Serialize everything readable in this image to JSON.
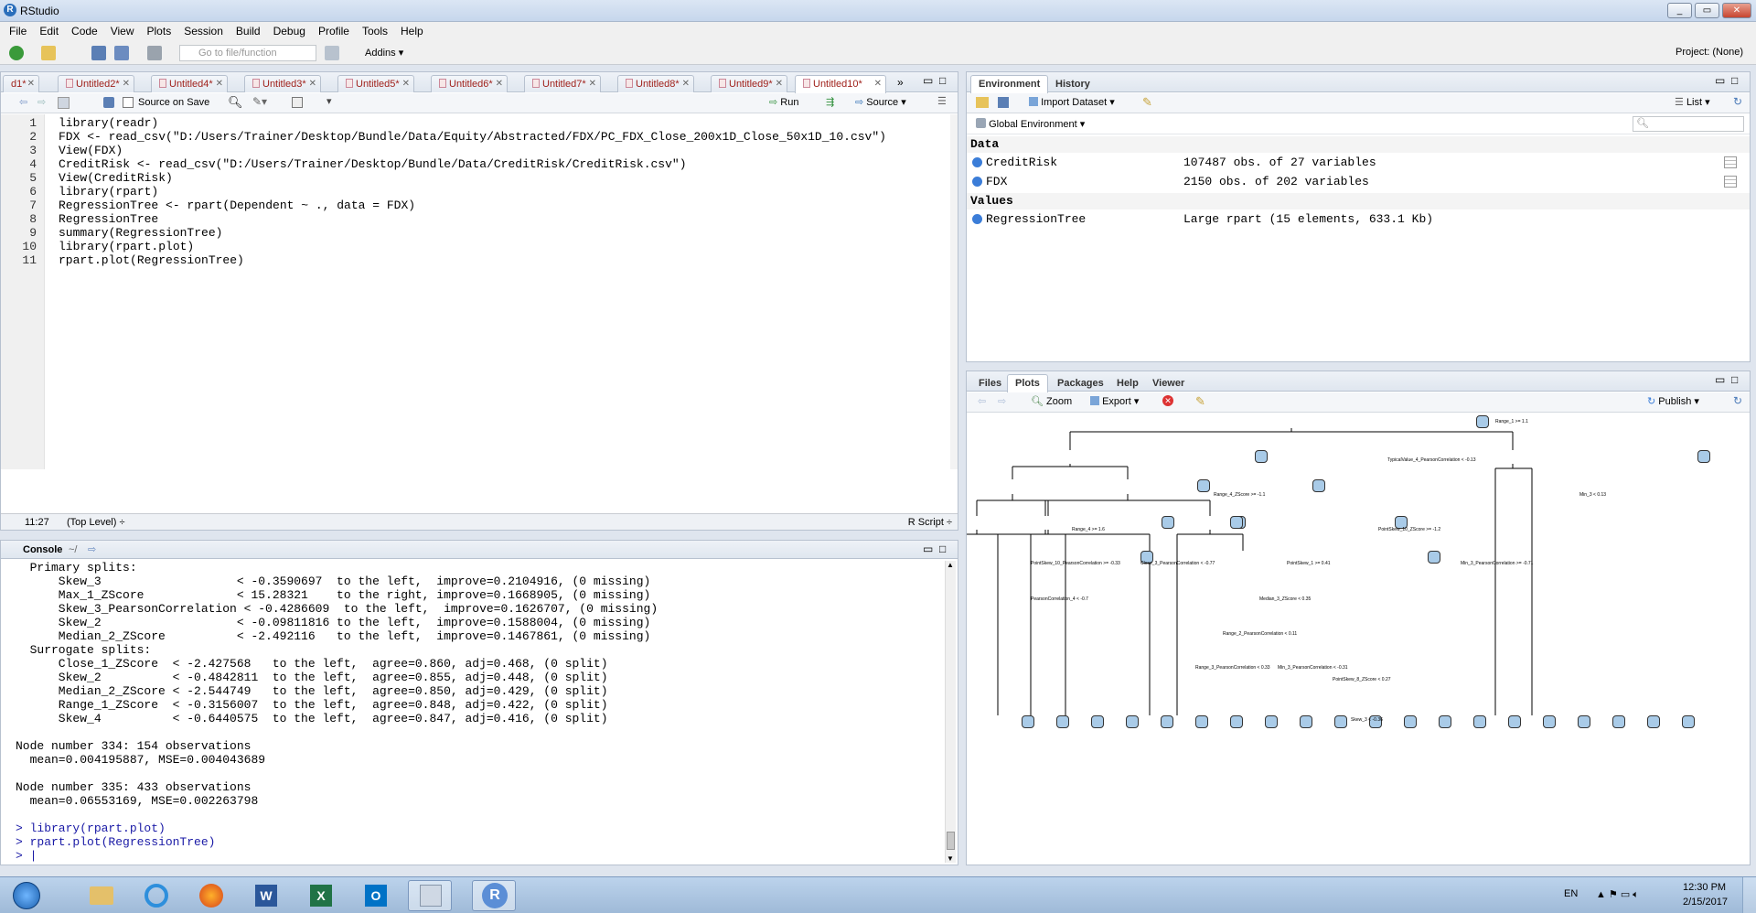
{
  "window": {
    "title": "RStudio"
  },
  "menu": [
    "File",
    "Edit",
    "Code",
    "View",
    "Plots",
    "Session",
    "Build",
    "Debug",
    "Profile",
    "Tools",
    "Help"
  ],
  "toolbar": {
    "goto_placeholder": "Go to file/function",
    "addins": "Addins",
    "project": "Project: (None)"
  },
  "editor": {
    "tabs": [
      "d1*",
      "Untitled2*",
      "Untitled4*",
      "Untitled3*",
      "Untitled5*",
      "Untitled6*",
      "Untitled7*",
      "Untitled8*",
      "Untitled9*",
      "Untitled10*"
    ],
    "source_on_save": "Source on Save",
    "run": "Run",
    "source": "Source",
    "lines": [
      "library(readr)",
      "FDX <- read_csv(\"D:/Users/Trainer/Desktop/Bundle/Data/Equity/Abstracted/FDX/PC_FDX_Close_200x1D_Close_50x1D_10.csv\")",
      "View(FDX)",
      "CreditRisk <- read_csv(\"D:/Users/Trainer/Desktop/Bundle/Data/CreditRisk/CreditRisk.csv\")",
      "View(CreditRisk)",
      "library(rpart)",
      "RegressionTree <- rpart(Dependent ~ ., data = FDX)",
      "RegressionTree",
      "summary(RegressionTree)",
      "library(rpart.plot)",
      "rpart.plot(RegressionTree)"
    ],
    "line_numbers": [
      "1",
      "2",
      "3",
      "4",
      "5",
      "6",
      "7",
      "8",
      "9",
      "10",
      "11"
    ],
    "status_pos": "11:27",
    "status_scope": "(Top Level) ÷",
    "status_type": "R Script ÷"
  },
  "console": {
    "title": "Console",
    "path": "~/",
    "lines": [
      "  Primary splits:",
      "      Skew_3                   < -0.3590697  to the left,  improve=0.2104916, (0 missing)",
      "      Max_1_ZScore             < 15.28321    to the right, improve=0.1668905, (0 missing)",
      "      Skew_3_PearsonCorrelation < -0.4286609  to the left,  improve=0.1626707, (0 missing)",
      "      Skew_2                   < -0.09811816 to the left,  improve=0.1588004, (0 missing)",
      "      Median_2_ZScore          < -2.492116   to the left,  improve=0.1467861, (0 missing)",
      "  Surrogate splits:",
      "      Close_1_ZScore  < -2.427568   to the left,  agree=0.860, adj=0.468, (0 split)",
      "      Skew_2          < -0.4842811  to the left,  agree=0.855, adj=0.448, (0 split)",
      "      Median_2_ZScore < -2.544749   to the left,  agree=0.850, adj=0.429, (0 split)",
      "      Range_1_ZScore  < -0.3156007  to the left,  agree=0.848, adj=0.422, (0 split)",
      "      Skew_4          < -0.6440575  to the left,  agree=0.847, adj=0.416, (0 split)",
      "",
      "Node number 334: 154 observations",
      "  mean=0.004195887, MSE=0.004043689",
      "",
      "Node number 335: 433 observations",
      "  mean=0.06553169, MSE=0.002263798",
      "",
      "> library(rpart.plot)",
      "> rpart.plot(RegressionTree)",
      "> |"
    ]
  },
  "environment": {
    "tabs": [
      "Environment",
      "History"
    ],
    "import_dataset": "Import Dataset",
    "view_mode": "List",
    "scope": "Global Environment",
    "data_header": "Data",
    "values_header": "Values",
    "data": [
      {
        "name": "CreditRisk",
        "value": "107487 obs. of 27 variables"
      },
      {
        "name": "FDX",
        "value": "2150 obs. of 202 variables"
      }
    ],
    "values": [
      {
        "name": "RegressionTree",
        "value": "Large rpart (15 elements, 633.1 Kb)"
      }
    ]
  },
  "files_pane": {
    "tabs": [
      "Files",
      "Plots",
      "Packages",
      "Help",
      "Viewer"
    ],
    "zoom": "Zoom",
    "export": "Export",
    "publish": "Publish"
  },
  "tree_plot": {
    "root_split": "Range_1 >= 1.1",
    "split_labels": [
      "TypicalValue_4_PearsonCorrelation < -0.13",
      "Range_4_ZScore >= -1.1",
      "Min_3 < 0.13",
      "Range_4 >= 1.6",
      "PointSkew_10_ZScore >= -1.2",
      "PointSkew_10_PearsonCorrelation >= -0.33",
      "Close_3_PearsonCorrelation < -0.77",
      "PointSkew_1 >= 0.41",
      "Min_3_PearsonCorrelation >= -0.71",
      "PearsonCorrelation_4 < -0.7",
      "Range_2_PearsonCorrelation < 0.11",
      "Median_3_ZScore < 0.35",
      "Range_3_PearsonCorrelation < 0.33",
      "Min_3_PearsonCorrelation < -0.31",
      "PointSkew_8_ZScore < 0.27",
      "Skew_3 < -0.36"
    ]
  },
  "taskbar": {
    "lang": "EN",
    "time": "12:30 PM",
    "date": "2/15/2017"
  }
}
